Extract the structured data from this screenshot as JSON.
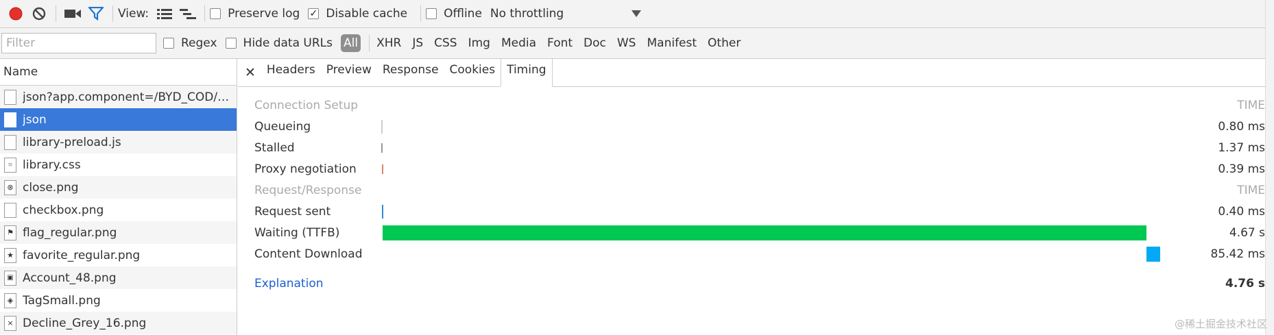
{
  "toolbar": {
    "view_label": "View:",
    "preserve_log": "Preserve log",
    "preserve_log_checked": false,
    "disable_cache": "Disable cache",
    "disable_cache_checked": true,
    "offline": "Offline",
    "offline_checked": false,
    "throttling": "No throttling"
  },
  "filterbar": {
    "placeholder": "Filter",
    "regex": "Regex",
    "hide_data_urls": "Hide data URLs",
    "types": [
      "All",
      "XHR",
      "JS",
      "CSS",
      "Img",
      "Media",
      "Font",
      "Doc",
      "WS",
      "Manifest",
      "Other"
    ]
  },
  "requests": {
    "header": "Name",
    "items": [
      {
        "name": "json?app.component=/BYD_COD/Sale...",
        "icon": "doc-icon"
      },
      {
        "name": "json",
        "icon": "doc-icon",
        "selected": true
      },
      {
        "name": "library-preload.js",
        "icon": "doc-icon"
      },
      {
        "name": "library.css",
        "icon": "stylesheet-icon"
      },
      {
        "name": "close.png",
        "icon": "close-icon"
      },
      {
        "name": "checkbox.png",
        "icon": "checkbox-icon"
      },
      {
        "name": "flag_regular.png",
        "icon": "flag-icon"
      },
      {
        "name": "favorite_regular.png",
        "icon": "star-icon"
      },
      {
        "name": "Account_48.png",
        "icon": "account-icon"
      },
      {
        "name": "TagSmall.png",
        "icon": "tag-icon"
      },
      {
        "name": "Decline_Grey_16.png",
        "icon": "decline-icon"
      }
    ]
  },
  "detail_tabs": {
    "tabs": [
      "Headers",
      "Preview",
      "Response",
      "Cookies",
      "Timing"
    ],
    "active": "Timing"
  },
  "timing": {
    "section1": "Connection Setup",
    "section2": "Request/Response",
    "time_header": "TIME",
    "rows": [
      {
        "label": "Queueing",
        "time": "0.80 ms",
        "color": "#cccccc"
      },
      {
        "label": "Stalled",
        "time": "1.37 ms",
        "color": "#999999"
      },
      {
        "label": "Proxy negotiation",
        "time": "0.39 ms",
        "color": "#d7856b"
      },
      {
        "label": "Request sent",
        "time": "0.40 ms",
        "color": "#2e8bd6"
      },
      {
        "label": "Waiting (TTFB)",
        "time": "4.67 s",
        "color": "#00c853",
        "fraction": 0.981
      },
      {
        "label": "Content Download",
        "time": "85.42 ms",
        "color": "#03a9f4",
        "fraction": 0.018
      }
    ],
    "explanation": "Explanation",
    "total": "4.76 s"
  },
  "watermark": "@稀土掘金技术社区"
}
